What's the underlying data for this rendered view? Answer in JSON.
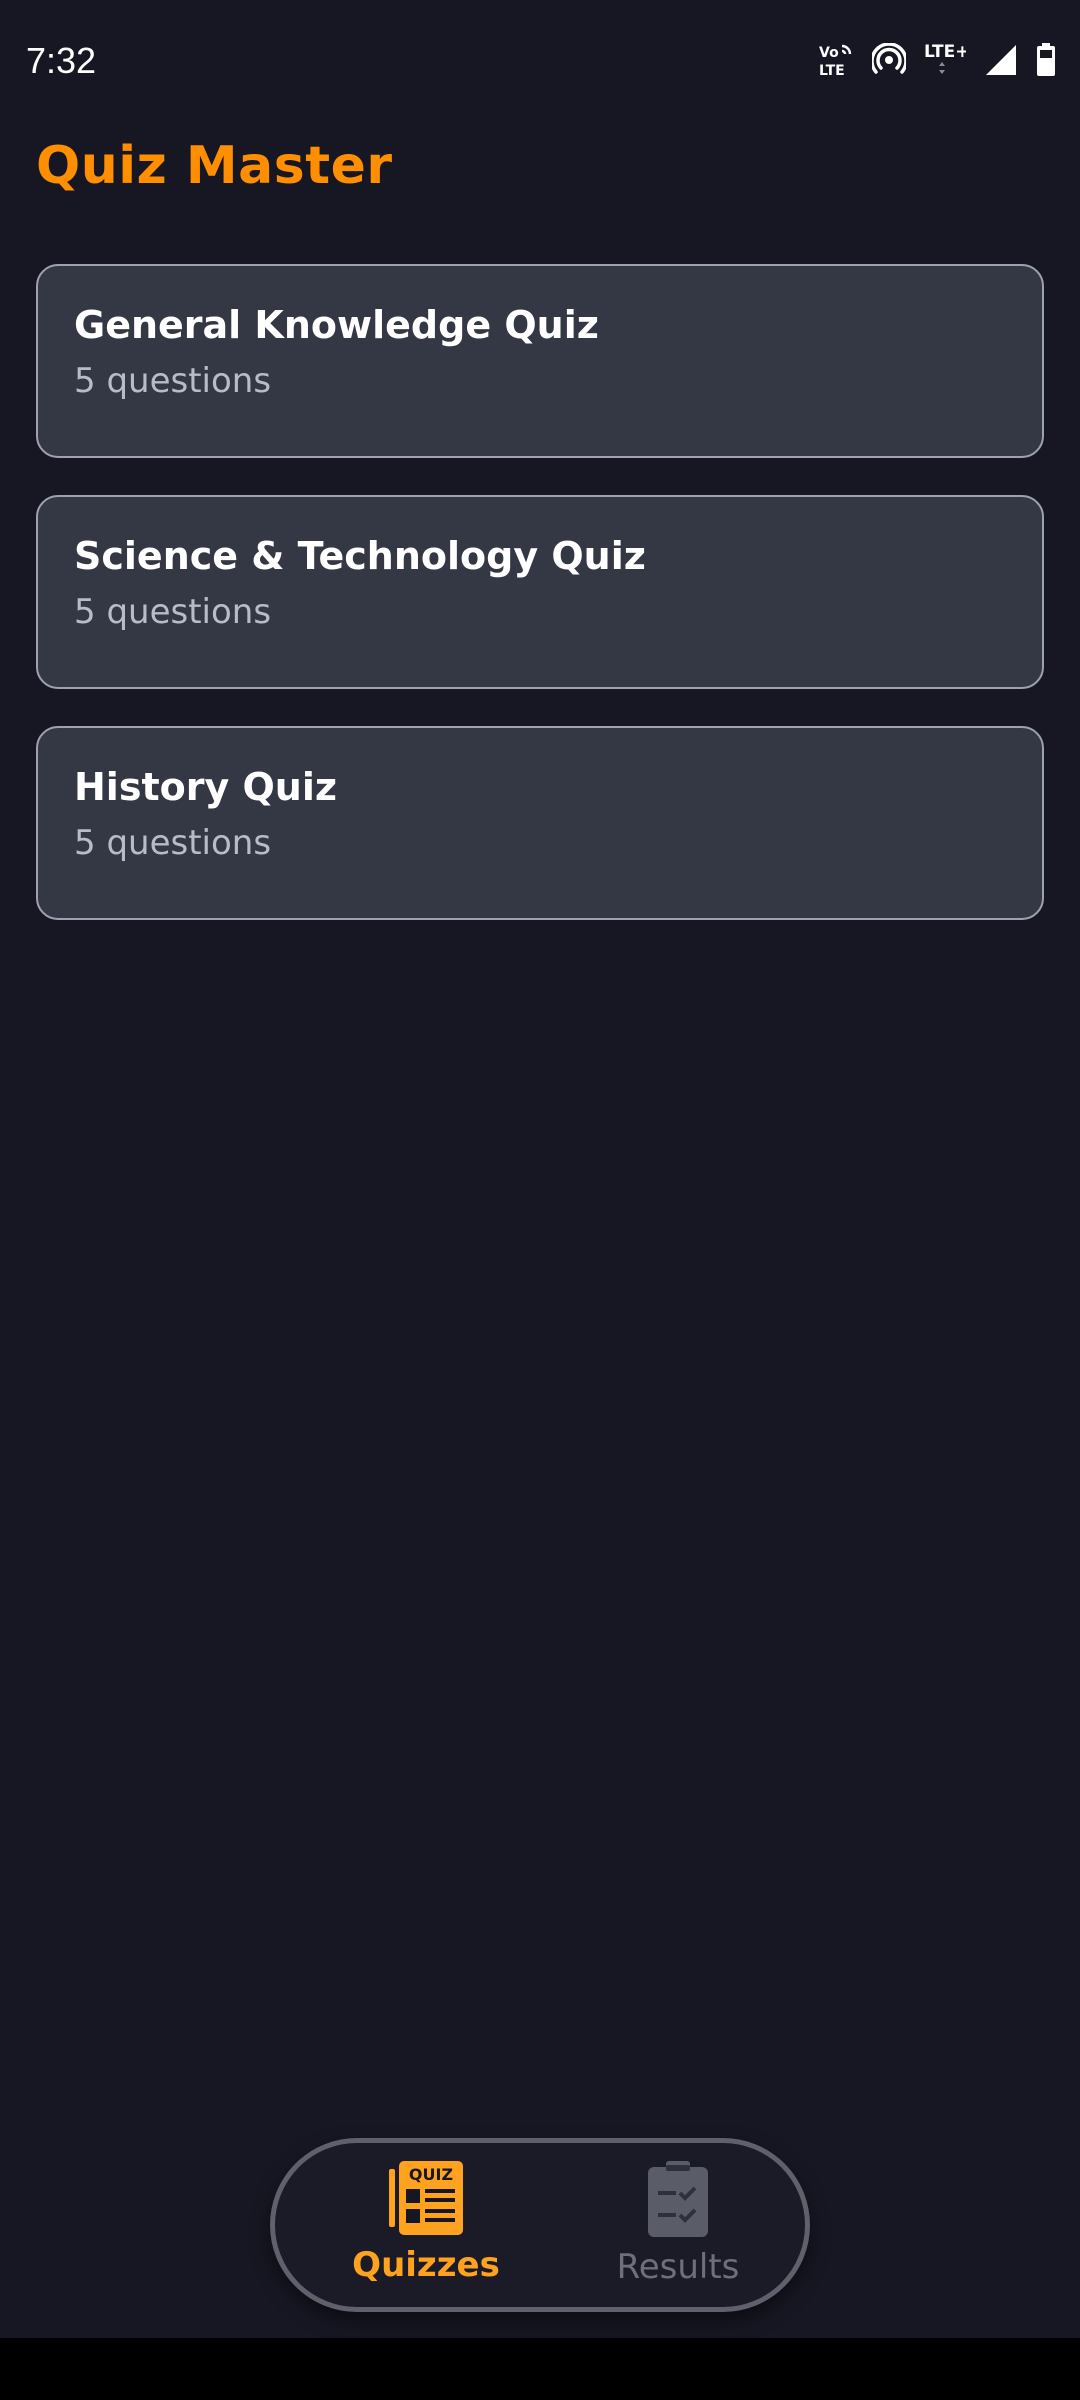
{
  "status_bar": {
    "time": "7:32",
    "icons": [
      "volte-icon",
      "hotspot-icon",
      "lte-plus-icon",
      "signal-icon",
      "battery-icon"
    ],
    "volte_text_top": "Vo",
    "volte_text_bottom": "LTE",
    "lte_text": "LTE+"
  },
  "app": {
    "title": "Quiz Master",
    "accent_color": "#ff8f00"
  },
  "quizzes": [
    {
      "title": "General Knowledge Quiz",
      "count": "5 questions"
    },
    {
      "title": "Science & Technology Quiz",
      "count": "5 questions"
    },
    {
      "title": "History Quiz",
      "count": "5 questions"
    }
  ],
  "bottom_nav": {
    "items": [
      {
        "label": "Quizzes",
        "icon": "quiz-icon",
        "icon_text": "QUIZ",
        "active": true
      },
      {
        "label": "Results",
        "icon": "clipboard-check-icon",
        "active": false
      }
    ]
  }
}
